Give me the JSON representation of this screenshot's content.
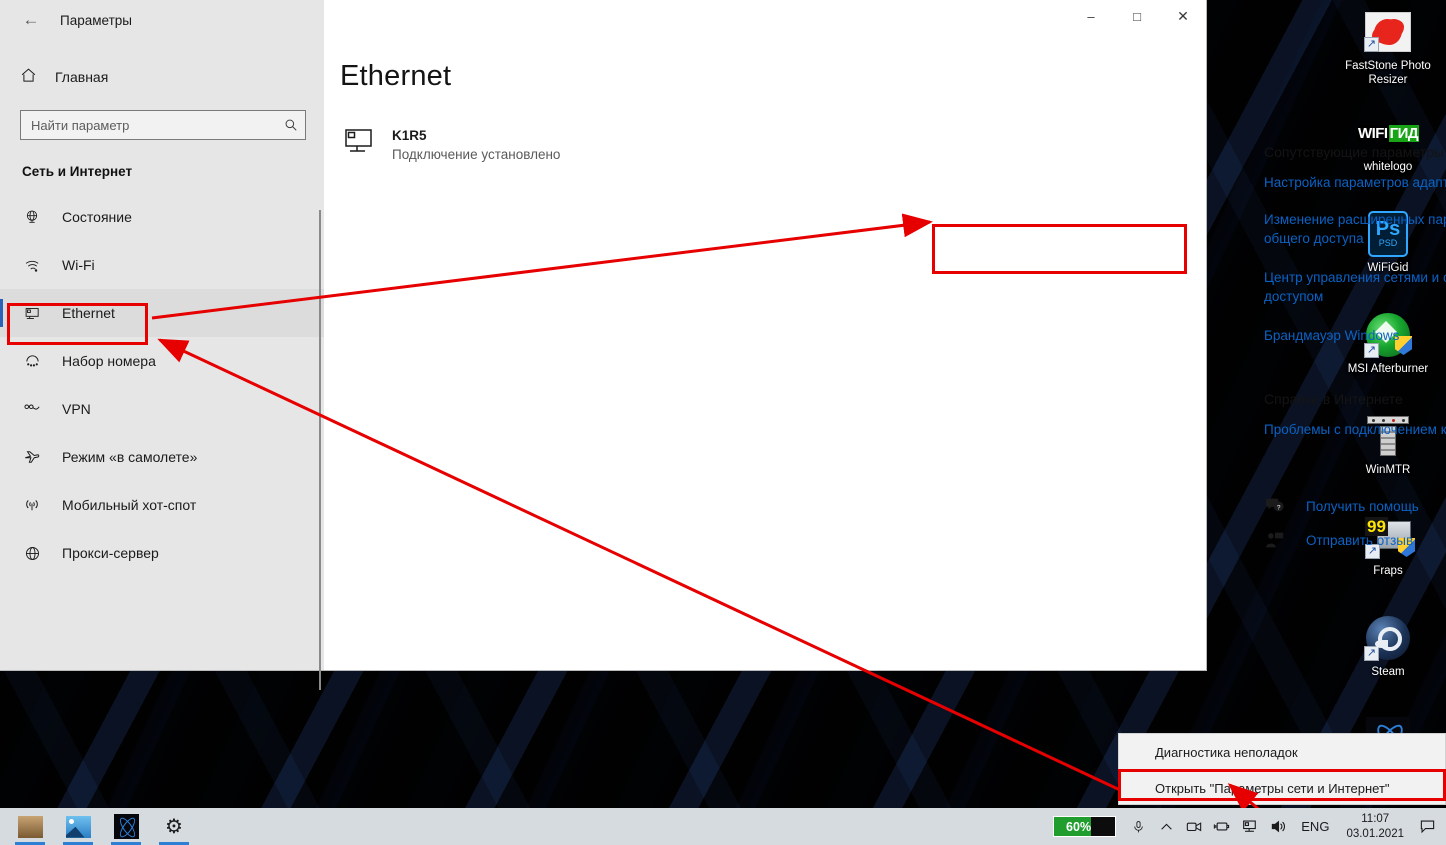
{
  "window": {
    "title": "Параметры",
    "back_icon": "back-arrow-icon",
    "minimize": "–",
    "maximize": "□",
    "close": "✕"
  },
  "sidebar": {
    "home_label": "Главная",
    "home_icon": "home-icon",
    "search": {
      "placeholder": "Найти параметр",
      "value": "",
      "icon": "search-icon"
    },
    "category": "Сеть и Интернет",
    "items": [
      {
        "label": "Состояние",
        "icon": "globe-status-icon",
        "selected": false
      },
      {
        "label": "Wi-Fi",
        "icon": "wifi-icon",
        "selected": false
      },
      {
        "label": "Ethernet",
        "icon": "ethernet-icon",
        "selected": true
      },
      {
        "label": "Набор номера",
        "icon": "dialup-icon",
        "selected": false
      },
      {
        "label": "VPN",
        "icon": "vpn-icon",
        "selected": false
      },
      {
        "label": "Режим «в самолете»",
        "icon": "airplane-icon",
        "selected": false
      },
      {
        "label": "Мобильный хот-спот",
        "icon": "hotspot-icon",
        "selected": false
      },
      {
        "label": "Прокси-сервер",
        "icon": "proxy-globe-icon",
        "selected": false
      }
    ]
  },
  "content": {
    "page_title": "Ethernet",
    "connection": {
      "icon": "ethernet-monitor-icon",
      "name": "K1R5",
      "status": "Подключение установлено"
    },
    "related": {
      "heading": "Сопутствующие параметры",
      "links": [
        "Настройка параметров адаптера",
        "Изменение расширенных параметров общего доступа",
        "Центр управления сетями и общим доступом",
        "Брандмауэр Windows"
      ]
    },
    "help": {
      "heading": "Справка в Интернете",
      "links": [
        "Проблемы с подключением к сети"
      ],
      "actions": [
        {
          "label": "Получить помощь",
          "icon": "question-bubble-icon"
        },
        {
          "label": "Отправить отзыв",
          "icon": "feedback-person-icon"
        }
      ]
    }
  },
  "context_menu": {
    "items": [
      "Диагностика неполадок",
      "Открыть \"Параметры сети и Интернет\""
    ]
  },
  "desktop_icons": [
    {
      "label": "FastStone Photo Resizer",
      "icon": "faststone-photo-resizer-icon"
    },
    {
      "label": "whitelogo",
      "icon": "wifigid-logo-icon"
    },
    {
      "label": "WiFiGid",
      "icon": "photoshop-psd-icon"
    },
    {
      "label": "MSI Afterburner",
      "icon": "msi-afterburner-icon"
    },
    {
      "label": "WinMTR",
      "icon": "winmtr-icon"
    },
    {
      "label": "Fraps",
      "icon": "fraps-icon"
    },
    {
      "label": "Steam",
      "icon": "steam-icon"
    }
  ],
  "taskbar": {
    "apps": [
      {
        "icon": "faststone-taskbar-icon"
      },
      {
        "icon": "photos-taskbar-icon"
      },
      {
        "icon": "atom-launcher-icon"
      },
      {
        "icon": "settings-gear-icon"
      }
    ],
    "tray": {
      "battery_percent": "60%",
      "battery_fill": 60,
      "icons": [
        "microphone-icon",
        "show-hidden-icons-chevron",
        "camera-icon",
        "battery-plug-icon",
        "network-ethernet-icon",
        "volume-icon"
      ],
      "language": "ENG",
      "time": "11:07",
      "date": "03.01.2021",
      "action_center": "notification-icon"
    }
  },
  "annotations": {
    "highlight_color": "#e60000",
    "boxes": [
      "ethernet-sidebar-item",
      "network-sharing-center-link",
      "tray-network-icon",
      "open-network-settings-menu-item"
    ]
  },
  "colors": {
    "accent": "#0b62c4",
    "selection_bar": "#2a62b8",
    "sidebar_bg": "#e6e6e6",
    "taskbar_bg": "#d6dbe0",
    "highlight": "#e60000"
  }
}
